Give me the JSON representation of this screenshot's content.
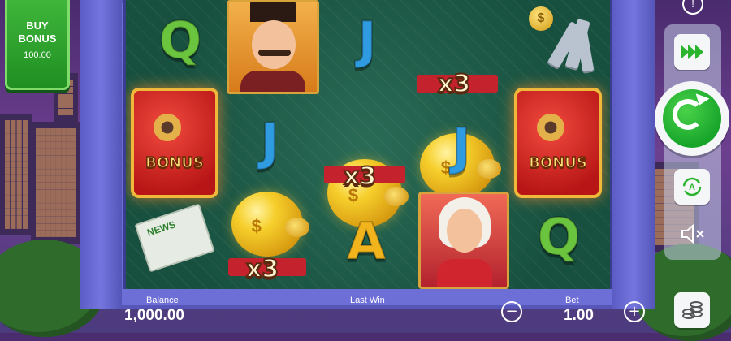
{
  "buy_bonus": {
    "label": "BUY BONUS",
    "price": "100.00"
  },
  "symbols": {
    "q": "Q",
    "j": "J",
    "a": "A",
    "multiplier": "x3",
    "bonus": "BONUS",
    "newspaper_headline": "NEWS",
    "coin_symbol": "$"
  },
  "stats": {
    "balance_label": "Balance",
    "balance_value": "1,000.00",
    "last_win_label": "Last Win",
    "bet_label": "Bet",
    "bet_value": "1.00"
  },
  "controls": {
    "info": "!",
    "decrease": "−",
    "increase": "+"
  },
  "colors": {
    "spin_green": "#17a52a",
    "buy_bonus_green": "#1f8f22",
    "reel_bg": "#17503f"
  }
}
